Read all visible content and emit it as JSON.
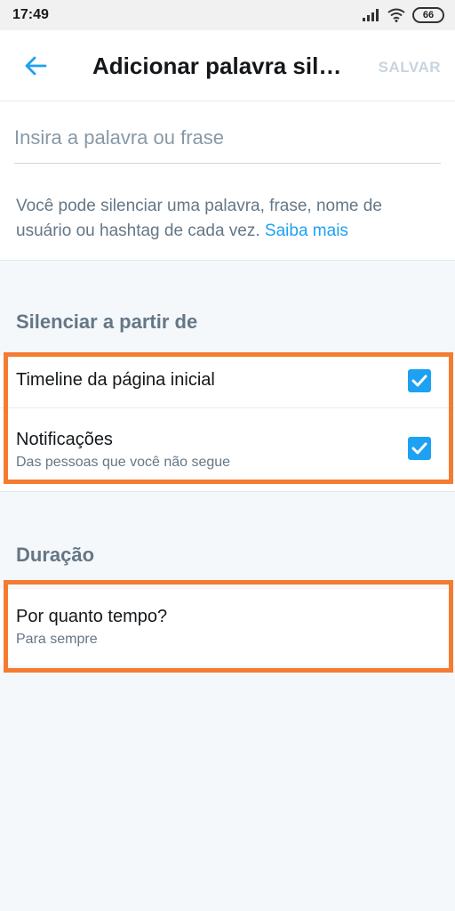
{
  "status_bar": {
    "time": "17:49",
    "battery": "66"
  },
  "header": {
    "title": "Adicionar palavra sil…",
    "save_label": "SALVAR"
  },
  "input": {
    "placeholder": "Insira a palavra ou frase",
    "value": ""
  },
  "help": {
    "text": "Você pode silenciar uma palavra, frase, nome de usuário ou hashtag de cada vez.",
    "link": "Saiba mais"
  },
  "mute_from": {
    "title": "Silenciar a partir de",
    "options": [
      {
        "label": "Timeline da página inicial",
        "sublabel": "",
        "checked": true
      },
      {
        "label": "Notificações",
        "sublabel": "Das pessoas que você não segue",
        "checked": true
      }
    ]
  },
  "duration": {
    "title": "Duração",
    "label": "Por quanto tempo?",
    "value": "Para sempre"
  },
  "colors": {
    "accent": "#1da1f2",
    "highlight": "#f47b30",
    "muted_text": "#657786",
    "section_bg": "#f5f8fa"
  },
  "icons": [
    "back-arrow-icon",
    "signal-icon",
    "wifi-icon",
    "battery-icon",
    "check-icon"
  ]
}
